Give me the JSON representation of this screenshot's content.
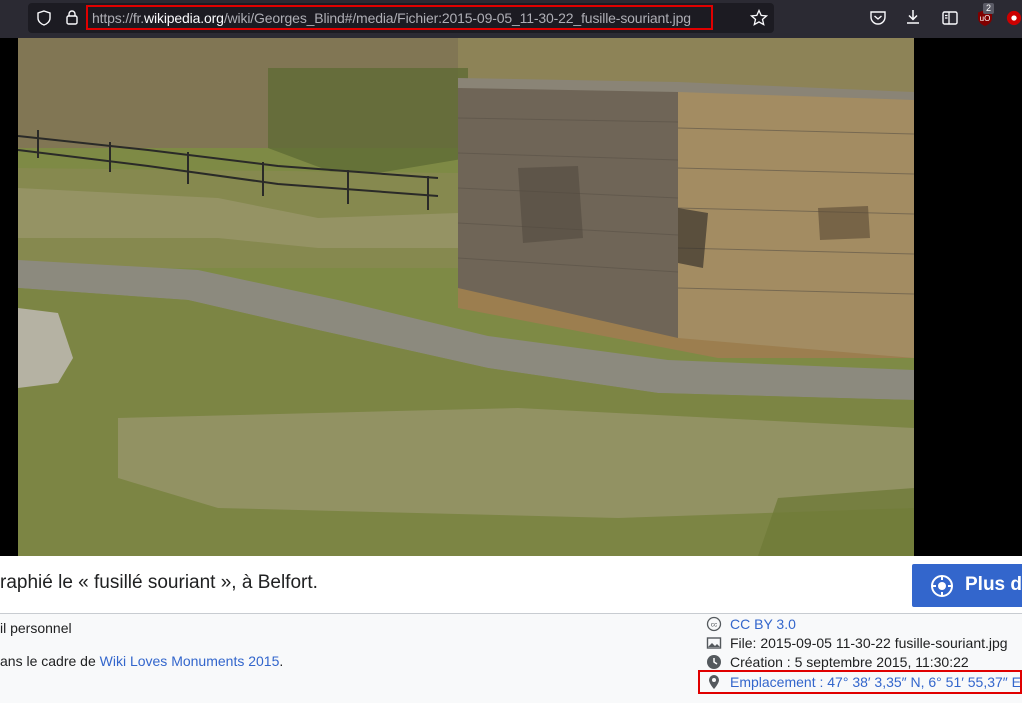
{
  "browser": {
    "url_prefix": "https://fr.",
    "url_domain": "wikipedia.org",
    "url_path": "/wiki/Georges_Blind#/media/Fichier:2015-09-05_11-30-22_fusille-souriant.jpg",
    "extension_badge": "2",
    "icons": [
      "shield-icon",
      "lock-icon",
      "star-icon",
      "pocket-icon",
      "download-icon",
      "reader-view-icon",
      "ublock-icon",
      "extension-icon"
    ]
  },
  "media": {
    "caption": "raphié le « fusillé souriant », à Belfort.",
    "more_button_label": "Plus d",
    "author_fragment": "il personnel",
    "context_prefix": "ans le cadre de ",
    "context_link": "Wiki Loves Monuments 2015",
    "context_suffix": ".",
    "license": "CC BY 3.0",
    "file": "File: 2015-09-05 11-30-22 fusille-souriant.jpg",
    "creation": "Création : 5 septembre 2015, 11:30:22",
    "location": "Emplacement : 47° 38′ 3,35″ N, 6° 51′ 55,37″ E"
  },
  "colors": {
    "link": "#3366cc",
    "highlight": "#e00000",
    "toolbar": "#2b2a33"
  }
}
